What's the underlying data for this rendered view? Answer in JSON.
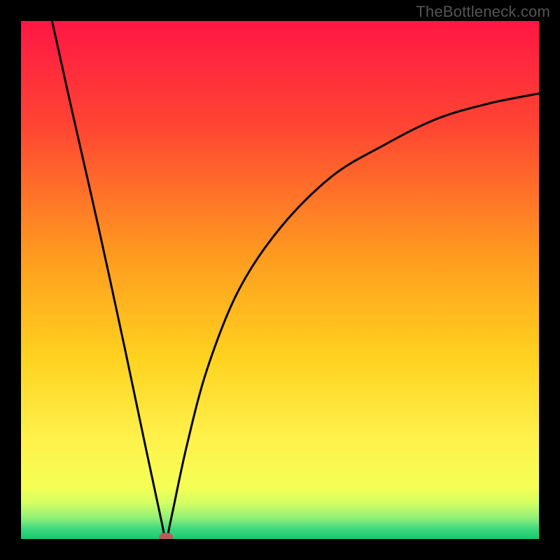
{
  "watermark": "TheBottleneck.com",
  "chart_data": {
    "type": "line",
    "title": "",
    "xlabel": "",
    "ylabel": "",
    "xlim": [
      0,
      100
    ],
    "ylim": [
      0,
      100
    ],
    "notch": {
      "x": 28,
      "y": 0
    },
    "series": [
      {
        "name": "curve",
        "points": [
          {
            "x": 6,
            "y": 100
          },
          {
            "x": 10,
            "y": 82
          },
          {
            "x": 15,
            "y": 60
          },
          {
            "x": 20,
            "y": 37
          },
          {
            "x": 24,
            "y": 18
          },
          {
            "x": 27,
            "y": 4
          },
          {
            "x": 28,
            "y": 0
          },
          {
            "x": 29,
            "y": 4
          },
          {
            "x": 32,
            "y": 18
          },
          {
            "x": 36,
            "y": 33
          },
          {
            "x": 42,
            "y": 48
          },
          {
            "x": 50,
            "y": 60
          },
          {
            "x": 60,
            "y": 70
          },
          {
            "x": 70,
            "y": 76
          },
          {
            "x": 80,
            "y": 81
          },
          {
            "x": 90,
            "y": 84
          },
          {
            "x": 100,
            "y": 86
          }
        ]
      }
    ],
    "gradient_stops": [
      {
        "offset": 0.0,
        "color": "#ff1744"
      },
      {
        "offset": 0.2,
        "color": "#ff4433"
      },
      {
        "offset": 0.45,
        "color": "#ff9a1f"
      },
      {
        "offset": 0.65,
        "color": "#ffd21f"
      },
      {
        "offset": 0.8,
        "color": "#fff04a"
      },
      {
        "offset": 0.9,
        "color": "#f5ff55"
      },
      {
        "offset": 0.93,
        "color": "#d4ff62"
      },
      {
        "offset": 0.96,
        "color": "#8fef78"
      },
      {
        "offset": 0.98,
        "color": "#3fd97f"
      },
      {
        "offset": 1.0,
        "color": "#18c96e"
      }
    ],
    "marker": {
      "x": 28,
      "y": 0,
      "color": "#bb5a5a",
      "rx": 10,
      "ry": 6
    }
  }
}
